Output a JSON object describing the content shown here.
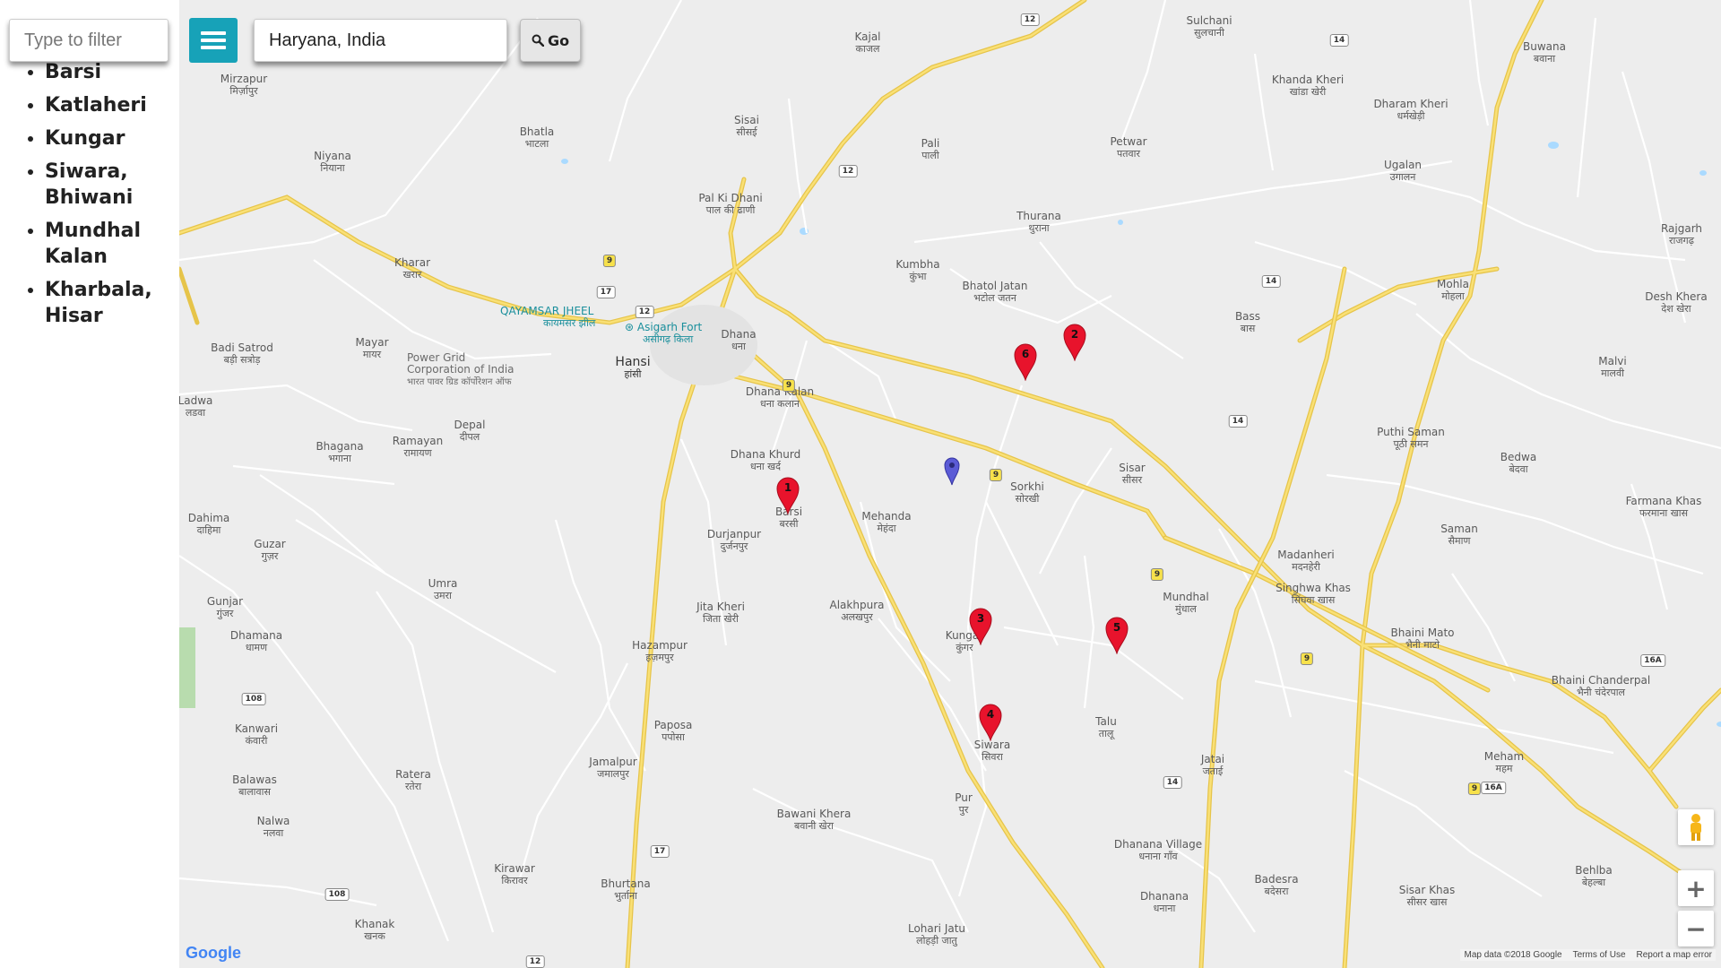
{
  "sidebar": {
    "filter_placeholder": "Type to filter",
    "places": [
      "Barsi",
      "Katlaheri",
      "Kungar",
      "Siwara, Bhiwani",
      "Mundhal Kalan",
      "Kharbala, Hisar"
    ]
  },
  "toolbar": {
    "menu_icon": "hamburger-icon",
    "search_value": "Haryana, India",
    "go_label": "Go",
    "go_icon": "search-icon",
    "accent_color": "#17a2b8"
  },
  "map": {
    "towns": [
      {
        "en": "Mirzapur",
        "dev": "मिर्ज़ापुर"
      },
      {
        "en": "Niyana",
        "dev": "नियाना"
      },
      {
        "en": "Kharar",
        "dev": "खरार"
      },
      {
        "en": "Badi Satrod",
        "dev": "बड़ी सत्रोड़"
      },
      {
        "en": "Mayar",
        "dev": "मायर"
      },
      {
        "en": "Ladwa",
        "dev": "लडवा"
      },
      {
        "en": "Bhagana",
        "dev": "भगाना"
      },
      {
        "en": "Ramayan",
        "dev": "रामायण"
      },
      {
        "en": "Depal",
        "dev": "दीपल"
      },
      {
        "en": "Dahima",
        "dev": "दाहिमा"
      },
      {
        "en": "Guzar",
        "dev": "गुज़र"
      },
      {
        "en": "Umra",
        "dev": "उमरा"
      },
      {
        "en": "Gunjar",
        "dev": "गुंजर"
      },
      {
        "en": "Dhamana",
        "dev": "धामण"
      },
      {
        "en": "Kanwari",
        "dev": "कंवारी"
      },
      {
        "en": "Balawas",
        "dev": "बालावास"
      },
      {
        "en": "Ratera",
        "dev": "रतेरा"
      },
      {
        "en": "Nalwa",
        "dev": "नलवा"
      },
      {
        "en": "Kirawar",
        "dev": "किरावर"
      },
      {
        "en": "Khanak",
        "dev": "खनक"
      },
      {
        "en": "Bhatla",
        "dev": "भाटला"
      },
      {
        "en": "Sisai",
        "dev": "सीसई"
      },
      {
        "en": "Kajal",
        "dev": "काजल"
      },
      {
        "en": "Pali",
        "dev": "पाली"
      },
      {
        "en": "Pal Ki Dhani",
        "dev": "पाल की ढाणी"
      },
      {
        "en": "Hansi",
        "dev": "हांसी"
      },
      {
        "en": "Dhana",
        "dev": "धना"
      },
      {
        "en": "Dhana Kalan",
        "dev": "धना कलान"
      },
      {
        "en": "Dhana Khurd",
        "dev": "धना खर्द"
      },
      {
        "en": "Barsi",
        "dev": "बरसी"
      },
      {
        "en": "Durjanpur",
        "dev": "दुर्जनपुर"
      },
      {
        "en": "Mehanda",
        "dev": "मेहंदा"
      },
      {
        "en": "Jita Kheri",
        "dev": "जिता खेरी"
      },
      {
        "en": "Alakhpura",
        "dev": "अलखपुर"
      },
      {
        "en": "Hazampur",
        "dev": "हज़मपुर"
      },
      {
        "en": "Paposa",
        "dev": "पपोसा"
      },
      {
        "en": "Jamalpur",
        "dev": "जमालपुर"
      },
      {
        "en": "Bawani Khera",
        "dev": "बवानी खेरा"
      },
      {
        "en": "Bhurtana",
        "dev": "भुर्ताना"
      },
      {
        "en": "Lohari Jatu",
        "dev": "लोहड़ी जातु"
      },
      {
        "en": "Kumbha",
        "dev": "कुंभा"
      },
      {
        "en": "Bhatol Jatan",
        "dev": "भटोल जतन"
      },
      {
        "en": "Thurana",
        "dev": "थुराना"
      },
      {
        "en": "Petwar",
        "dev": "पतवार"
      },
      {
        "en": "Sulchani",
        "dev": "सुलचानी"
      },
      {
        "en": "Sorkhi",
        "dev": "सोरखी"
      },
      {
        "en": "Sisar",
        "dev": "सीसर"
      },
      {
        "en": "Kungar",
        "dev": "कुंगर"
      },
      {
        "en": "Siwara",
        "dev": "सिवरा"
      },
      {
        "en": "Talu",
        "dev": "तालू"
      },
      {
        "en": "Pur",
        "dev": "पुर"
      },
      {
        "en": "Mundhal",
        "dev": "मुंधाल"
      },
      {
        "en": "Jatai",
        "dev": "जताई"
      },
      {
        "en": "Dhanana Village",
        "dev": "धनाना गाँव"
      },
      {
        "en": "Dhanana",
        "dev": "धनाना"
      },
      {
        "en": "Khanda Kheri",
        "dev": "खांडा खेरी"
      },
      {
        "en": "Dharam Kheri",
        "dev": "धर्मखेड़ी"
      },
      {
        "en": "Ugalan",
        "dev": "उगालन"
      },
      {
        "en": "Buwana",
        "dev": "बवाना"
      },
      {
        "en": "Bass",
        "dev": "बास"
      },
      {
        "en": "Mohla",
        "dev": "मोहला"
      },
      {
        "en": "Puthi Saman",
        "dev": "पूठी समन"
      },
      {
        "en": "Madanheri",
        "dev": "मदनहेरी"
      },
      {
        "en": "Singhwa Khas",
        "dev": "सिंघवा खास"
      },
      {
        "en": "Saman",
        "dev": "सैमाण"
      },
      {
        "en": "Bhaini Mato",
        "dev": "भैनी माटो"
      },
      {
        "en": "Bedwa",
        "dev": "बेदवा"
      },
      {
        "en": "Malvi",
        "dev": "मालवी"
      },
      {
        "en": "Desh Khera",
        "dev": "देश खेरा"
      },
      {
        "en": "Rajgarh",
        "dev": "राजगढ़"
      },
      {
        "en": "Farmana Khas",
        "dev": "फरमाना खास"
      },
      {
        "en": "Bhaini Chanderpal",
        "dev": "भैनी चंदेरपाल"
      },
      {
        "en": "Meham",
        "dev": "महम"
      },
      {
        "en": "Badesra",
        "dev": "बदेसरा"
      },
      {
        "en": "Sisar Khas",
        "dev": "सीसर खास"
      },
      {
        "en": "Behlba",
        "dev": "बेहल्बा"
      }
    ],
    "pois": [
      "QAYAMSAR JHEEL",
      "कायमसर झील",
      "Asigarh Fort",
      "असीगढ़ किला",
      "Power Grid Corporation of India",
      "भारत पावर ग्रिड कॉर्पोरेशन ऑफ"
    ],
    "highway_shields": [
      "12",
      "12",
      "12",
      "12",
      "14",
      "14",
      "14",
      "14",
      "17",
      "17",
      "9",
      "9",
      "9",
      "9",
      "9",
      "9",
      "16A",
      "16A",
      "108",
      "108"
    ],
    "markers": [
      "1",
      "2",
      "3",
      "4",
      "5",
      "6"
    ],
    "marker_color": "#e8132c",
    "current_location_color": "#5b5bd6",
    "zoom_in": "+",
    "zoom_out": "−",
    "google_logo": "Google",
    "attribution": {
      "map_data": "Map data ©2018 Google",
      "terms": "Terms of Use",
      "report": "Report a map error"
    }
  }
}
